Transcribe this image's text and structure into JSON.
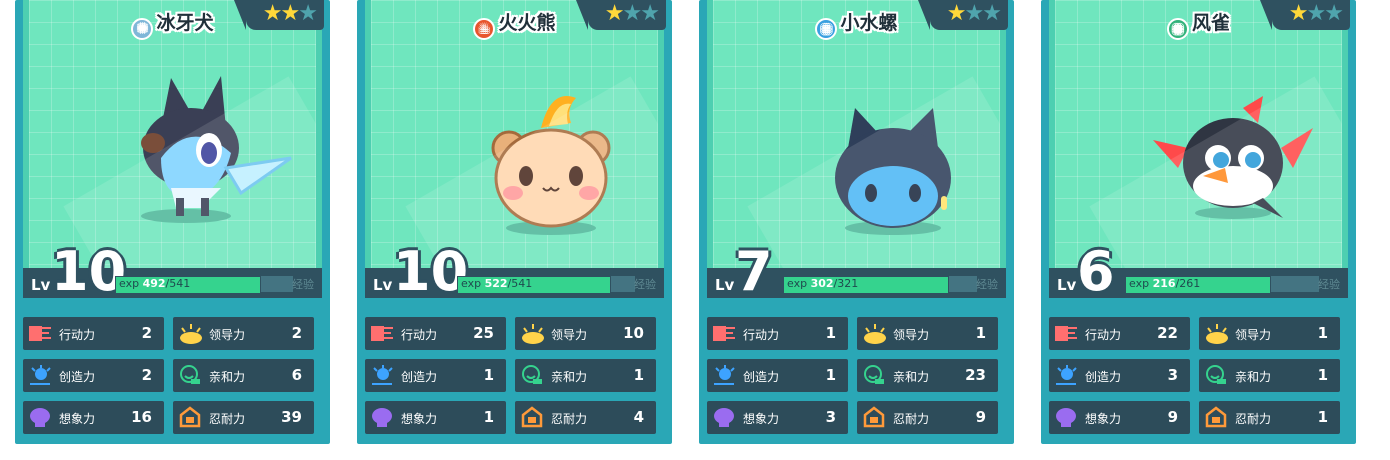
{
  "cards": [
    {
      "name": "冰牙犬",
      "element": "ice",
      "stars": 2,
      "level": "10",
      "exp_current": "492",
      "exp_max": "541",
      "exp_fraction": 0.909,
      "stats": {
        "action": "2",
        "leader": "2",
        "create": "2",
        "affinity": "6",
        "imagine": "16",
        "endure": "39"
      }
    },
    {
      "name": "火火熊",
      "element": "fire",
      "stars": 1,
      "level": "10",
      "exp_current": "522",
      "exp_max": "541",
      "exp_fraction": 0.965,
      "stats": {
        "action": "25",
        "leader": "10",
        "create": "1",
        "affinity": "1",
        "imagine": "1",
        "endure": "4"
      }
    },
    {
      "name": "小水螺",
      "element": "water",
      "stars": 1,
      "level": "7",
      "exp_current": "302",
      "exp_max": "321",
      "exp_fraction": 0.941,
      "stats": {
        "action": "1",
        "leader": "1",
        "create": "1",
        "affinity": "23",
        "imagine": "3",
        "endure": "9"
      }
    },
    {
      "name": "风雀",
      "element": "wind",
      "stars": 1,
      "level": "6",
      "exp_current": "216",
      "exp_max": "261",
      "exp_fraction": 0.828,
      "stats": {
        "action": "22",
        "leader": "1",
        "create": "3",
        "affinity": "1",
        "imagine": "9",
        "endure": "1"
      }
    }
  ],
  "labels": {
    "lv": "Lv",
    "exp": "exp",
    "sep": "/",
    "exp_button": "经验",
    "action": "行动力",
    "leader": "领导力",
    "create": "创造力",
    "affinity": "亲和力",
    "imagine": "想象力",
    "endure": "忍耐力"
  },
  "colors": {
    "card": "#2aa7b6",
    "art": "#6fe6be",
    "panel": "#2f5160",
    "exp": "#35d38e",
    "star": "#ffd83a"
  },
  "icons": {
    "ice": "snowflake-icon",
    "fire": "flame-icon",
    "water": "water-drop-icon",
    "wind": "wind-swirl-icon"
  }
}
